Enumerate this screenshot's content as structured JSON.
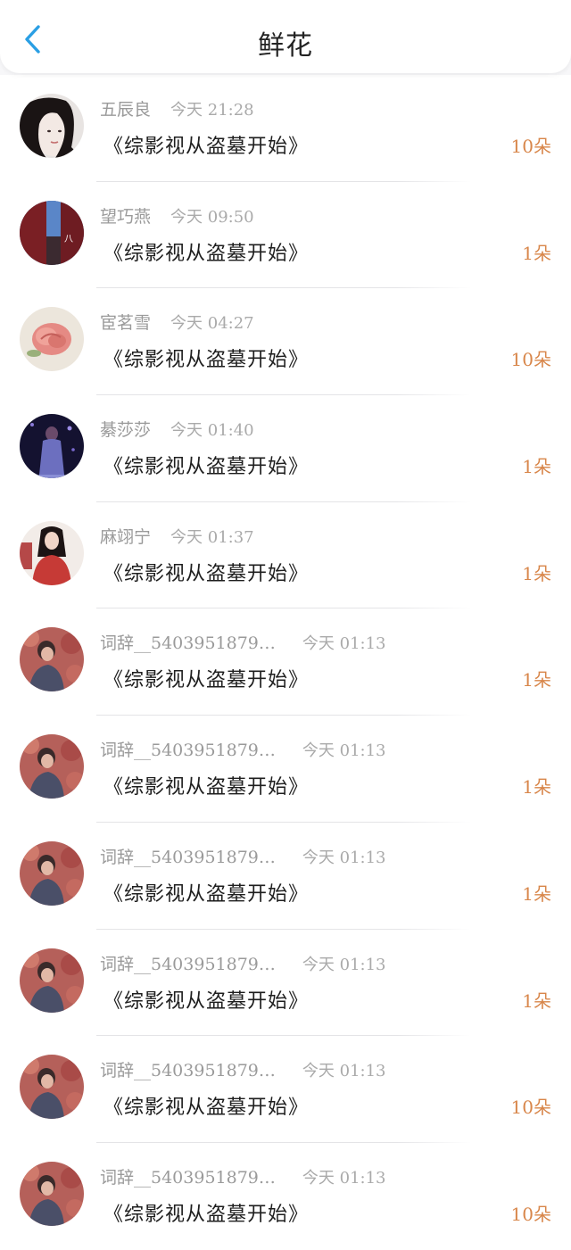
{
  "header": {
    "title": "鲜花",
    "back_icon": "chevron-left-icon",
    "accent": "#2a9fe4"
  },
  "colors": {
    "count": "#d8864a",
    "username": "#9a9a9a",
    "time": "#aaaaaa"
  },
  "items": [
    {
      "user": "五辰良",
      "time": "今天 21:28",
      "book": "《综影视从盗墓开始》",
      "count": "10朵",
      "avatar": "portrait-girl-white"
    },
    {
      "user": "望巧燕",
      "time": "今天 09:50",
      "book": "《综影视从盗墓开始》",
      "count": "1朵",
      "avatar": "red-wall-sky"
    },
    {
      "user": "宦茗雪",
      "time": "今天 04:27",
      "book": "《综影视从盗墓开始》",
      "count": "10朵",
      "avatar": "pink-rose"
    },
    {
      "user": "綦莎莎",
      "time": "今天 01:40",
      "book": "《综影视从盗墓开始》",
      "count": "1朵",
      "avatar": "stage-performer"
    },
    {
      "user": "麻翊宁",
      "time": "今天 01:37",
      "book": "《综影视从盗墓开始》",
      "count": "1朵",
      "avatar": "woman-red-dress"
    },
    {
      "user": "词辞__5403951879…",
      "time": "今天 01:13",
      "book": "《综影视从盗墓开始》",
      "count": "1朵",
      "avatar": "boy-red-leaves"
    },
    {
      "user": "词辞__5403951879…",
      "time": "今天 01:13",
      "book": "《综影视从盗墓开始》",
      "count": "1朵",
      "avatar": "boy-red-leaves"
    },
    {
      "user": "词辞__5403951879…",
      "time": "今天 01:13",
      "book": "《综影视从盗墓开始》",
      "count": "1朵",
      "avatar": "boy-red-leaves"
    },
    {
      "user": "词辞__5403951879…",
      "time": "今天 01:13",
      "book": "《综影视从盗墓开始》",
      "count": "1朵",
      "avatar": "boy-red-leaves"
    },
    {
      "user": "词辞__5403951879…",
      "time": "今天 01:13",
      "book": "《综影视从盗墓开始》",
      "count": "10朵",
      "avatar": "boy-red-leaves"
    },
    {
      "user": "词辞__5403951879…",
      "time": "今天 01:13",
      "book": "《综影视从盗墓开始》",
      "count": "10朵",
      "avatar": "boy-red-leaves"
    }
  ]
}
